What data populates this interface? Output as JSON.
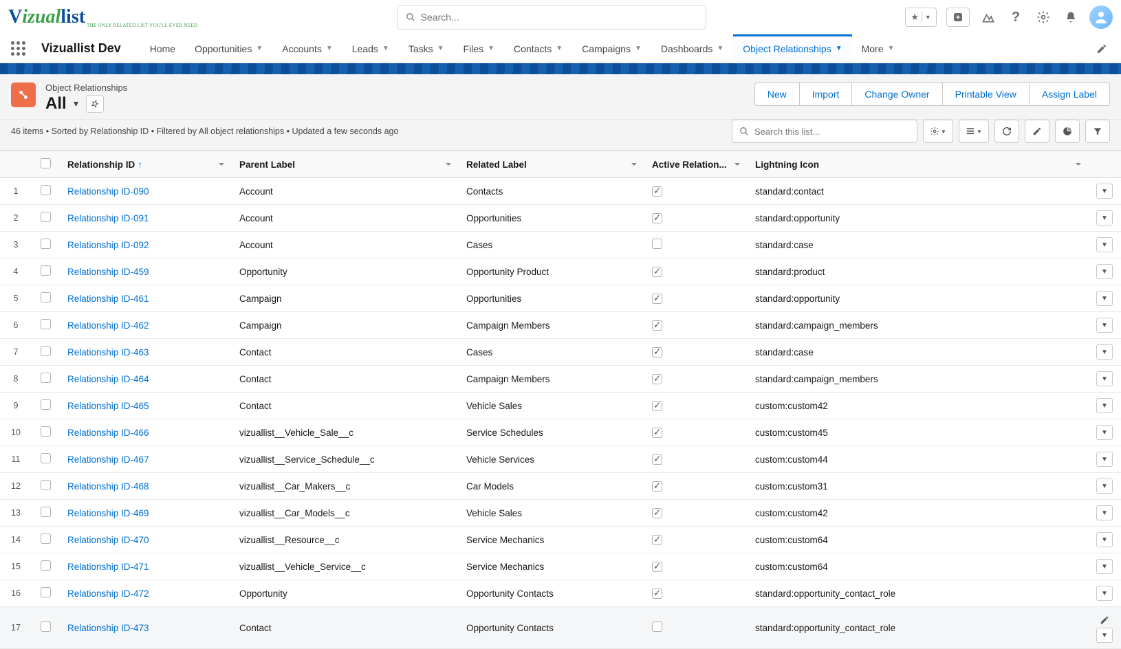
{
  "search_placeholder": "Search...",
  "app_name": "Vizuallist Dev",
  "nav": [
    {
      "label": "Home",
      "chev": false
    },
    {
      "label": "Opportunities",
      "chev": true
    },
    {
      "label": "Accounts",
      "chev": true
    },
    {
      "label": "Leads",
      "chev": true
    },
    {
      "label": "Tasks",
      "chev": true
    },
    {
      "label": "Files",
      "chev": true
    },
    {
      "label": "Contacts",
      "chev": true
    },
    {
      "label": "Campaigns",
      "chev": true
    },
    {
      "label": "Dashboards",
      "chev": true
    },
    {
      "label": "Object Relationships",
      "chev": true,
      "active": true
    },
    {
      "label": "More",
      "chev": true
    }
  ],
  "page": {
    "breadcrumb": "Object Relationships",
    "title": "All"
  },
  "actions": [
    "New",
    "Import",
    "Change Owner",
    "Printable View",
    "Assign Label"
  ],
  "list_search_placeholder": "Search this list...",
  "meta": "46 items • Sorted by Relationship ID • Filtered by All object relationships • Updated a few seconds ago",
  "columns": [
    "Relationship ID",
    "Parent Label",
    "Related Label",
    "Active Relation...",
    "Lightning Icon"
  ],
  "rows": [
    {
      "n": 1,
      "id": "Relationship ID-090",
      "parent": "Account",
      "related": "Contacts",
      "active": true,
      "icon": "standard:contact"
    },
    {
      "n": 2,
      "id": "Relationship ID-091",
      "parent": "Account",
      "related": "Opportunities",
      "active": true,
      "icon": "standard:opportunity"
    },
    {
      "n": 3,
      "id": "Relationship ID-092",
      "parent": "Account",
      "related": "Cases",
      "active": false,
      "icon": "standard:case"
    },
    {
      "n": 4,
      "id": "Relationship ID-459",
      "parent": "Opportunity",
      "related": "Opportunity Product",
      "active": true,
      "icon": "standard:product"
    },
    {
      "n": 5,
      "id": "Relationship ID-461",
      "parent": "Campaign",
      "related": "Opportunities",
      "active": true,
      "icon": "standard:opportunity"
    },
    {
      "n": 6,
      "id": "Relationship ID-462",
      "parent": "Campaign",
      "related": "Campaign Members",
      "active": true,
      "icon": "standard:campaign_members"
    },
    {
      "n": 7,
      "id": "Relationship ID-463",
      "parent": "Contact",
      "related": "Cases",
      "active": true,
      "icon": "standard:case"
    },
    {
      "n": 8,
      "id": "Relationship ID-464",
      "parent": "Contact",
      "related": "Campaign Members",
      "active": true,
      "icon": "standard:campaign_members"
    },
    {
      "n": 9,
      "id": "Relationship ID-465",
      "parent": "Contact",
      "related": "Vehicle Sales",
      "active": true,
      "icon": "custom:custom42"
    },
    {
      "n": 10,
      "id": "Relationship ID-466",
      "parent": "vizuallist__Vehicle_Sale__c",
      "related": "Service Schedules",
      "active": true,
      "icon": "custom:custom45"
    },
    {
      "n": 11,
      "id": "Relationship ID-467",
      "parent": "vizuallist__Service_Schedule__c",
      "related": "Vehicle Services",
      "active": true,
      "icon": "custom:custom44"
    },
    {
      "n": 12,
      "id": "Relationship ID-468",
      "parent": "vizuallist__Car_Makers__c",
      "related": "Car Models",
      "active": true,
      "icon": "custom:custom31"
    },
    {
      "n": 13,
      "id": "Relationship ID-469",
      "parent": "vizuallist__Car_Models__c",
      "related": "Vehicle Sales",
      "active": true,
      "icon": "custom:custom42"
    },
    {
      "n": 14,
      "id": "Relationship ID-470",
      "parent": "vizuallist__Resource__c",
      "related": "Service Mechanics",
      "active": true,
      "icon": "custom:custom64"
    },
    {
      "n": 15,
      "id": "Relationship ID-471",
      "parent": "vizuallist__Vehicle_Service__c",
      "related": "Service Mechanics",
      "active": true,
      "icon": "custom:custom64"
    },
    {
      "n": 16,
      "id": "Relationship ID-472",
      "parent": "Opportunity",
      "related": "Opportunity Contacts",
      "active": true,
      "icon": "standard:opportunity_contact_role"
    },
    {
      "n": 17,
      "id": "Relationship ID-473",
      "parent": "Contact",
      "related": "Opportunity Contacts",
      "active": false,
      "icon": "standard:opportunity_contact_role",
      "hover": true,
      "edit": true
    }
  ]
}
